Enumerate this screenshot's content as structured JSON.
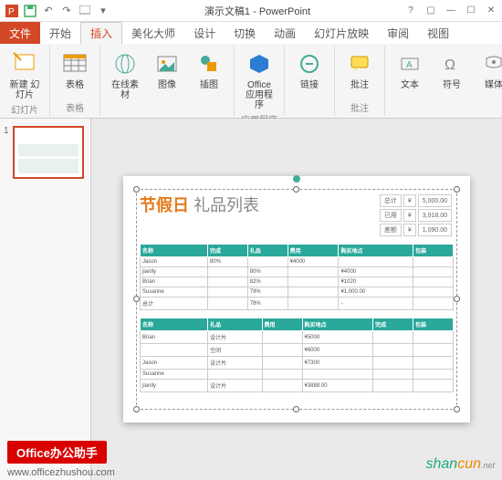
{
  "window": {
    "title": "演示文稿1 - PowerPoint"
  },
  "tabs": {
    "file": "文件",
    "home": "开始",
    "insert": "插入",
    "beautify": "美化大师",
    "design": "设计",
    "transition": "切换",
    "animation": "动画",
    "slideshow": "幻灯片放映",
    "review": "审阅",
    "view": "视图"
  },
  "ribbon": {
    "new_slide": "新建\n幻灯片",
    "slides_group": "幻灯片",
    "table": "表格",
    "tables_group": "表格",
    "online": "在线素\n材",
    "image": "图像",
    "illustration": "插图",
    "office_app": "Office\n应用程序",
    "apps_group": "应用程序",
    "link": "链接",
    "comment": "批注",
    "comments_group": "批注",
    "text": "文本",
    "symbol": "符号",
    "media": "媒体"
  },
  "thumb": {
    "num": "1"
  },
  "slide": {
    "title1": "节假日",
    "title2": "礼品列表",
    "summary": [
      [
        "总计",
        "¥",
        "5,000.00"
      ],
      [
        "已用",
        "¥",
        "3,918.00"
      ],
      [
        "差额",
        "¥",
        "1,090.00"
      ]
    ],
    "headers": [
      "名称",
      "完成",
      "礼品",
      "费用",
      "购买地点",
      "包装"
    ],
    "rows1": [
      [
        "Jason",
        "80%",
        "",
        "¥4000",
        "",
        ""
      ],
      [
        "jianlly",
        "",
        "80%",
        "",
        "¥4000",
        ""
      ],
      [
        "Brian",
        "",
        "82%",
        "",
        "¥1020",
        ""
      ],
      [
        "Susanne",
        "",
        "79%",
        "",
        "¥1.000.00",
        ""
      ],
      [
        "总计",
        "",
        "78%",
        "",
        "-",
        ""
      ]
    ],
    "headers2": [
      "名称",
      "礼品",
      "费用",
      "购买地点",
      "完成",
      "包装"
    ],
    "rows2": [
      [
        "Brian",
        "设计片",
        "",
        "¥5000",
        "",
        ""
      ],
      [
        "",
        "空间",
        "",
        "¥6000",
        "",
        ""
      ],
      [
        "Jason",
        "设计片",
        "",
        "¥7300",
        "",
        ""
      ],
      [
        "Susanne",
        "",
        "",
        "",
        "",
        ""
      ],
      [
        "jianlly",
        "设计片",
        "",
        "¥3888.00",
        "",
        ""
      ]
    ]
  },
  "watermark": {
    "ppt": "",
    "slide_wm": ""
  },
  "footer": {
    "badge": "Office办公助手",
    "url": "www.officezhushou.com",
    "logo1": "shan",
    "logo2": "cun",
    "logo_sub": ".net"
  }
}
